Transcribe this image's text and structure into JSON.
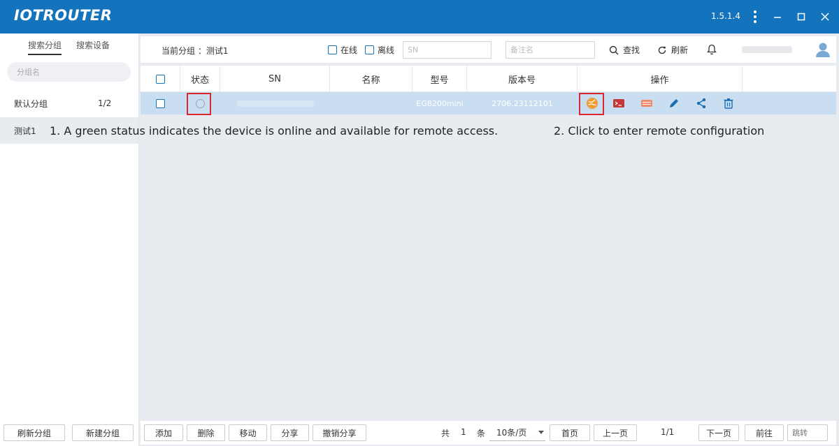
{
  "app": {
    "logo": "IOTROUTER",
    "version": "1.5.1.4"
  },
  "sidebar": {
    "tabs": [
      {
        "label": "搜索分组"
      },
      {
        "label": "搜索设备"
      }
    ],
    "search_placeholder": "分组名",
    "groups": [
      {
        "name": "默认分组",
        "count": "1/2"
      },
      {
        "name": "测试1",
        "count": ""
      }
    ],
    "buttons": {
      "refresh": "刷新分组",
      "new": "新建分组"
    }
  },
  "toolbar": {
    "current_group_label": "当前分组 ：测试1",
    "online": "在线",
    "offline": "离线",
    "sn_placeholder": "SN",
    "remark_placeholder": "备注名",
    "search": "查找",
    "refresh": "刷新"
  },
  "table": {
    "headers": [
      "状态",
      "SN",
      "名称",
      "型号",
      "版本号",
      "操作"
    ],
    "rows": [
      {
        "model": "EG8200mini",
        "version": "2706.23112101"
      }
    ]
  },
  "annotations": {
    "one": "1. A green status indicates the device is online and available for remote access.",
    "two": "2. Click to enter remote configuration"
  },
  "footer": {
    "add": "添加",
    "delete": "删除",
    "move": "移动",
    "share": "分享",
    "unshare": "撤销分享",
    "total_prefix": "共",
    "total": "1",
    "total_suffix": "条",
    "page_size": "10条/页",
    "first": "首页",
    "prev": "上一页",
    "page_info": "1/1",
    "next": "下一页",
    "goto": "前往",
    "jump_placeholder": "跳转"
  },
  "colors": {
    "titlebar": "#1473bd",
    "row_selected": "#c9def0",
    "highlight": "#d9262c"
  }
}
